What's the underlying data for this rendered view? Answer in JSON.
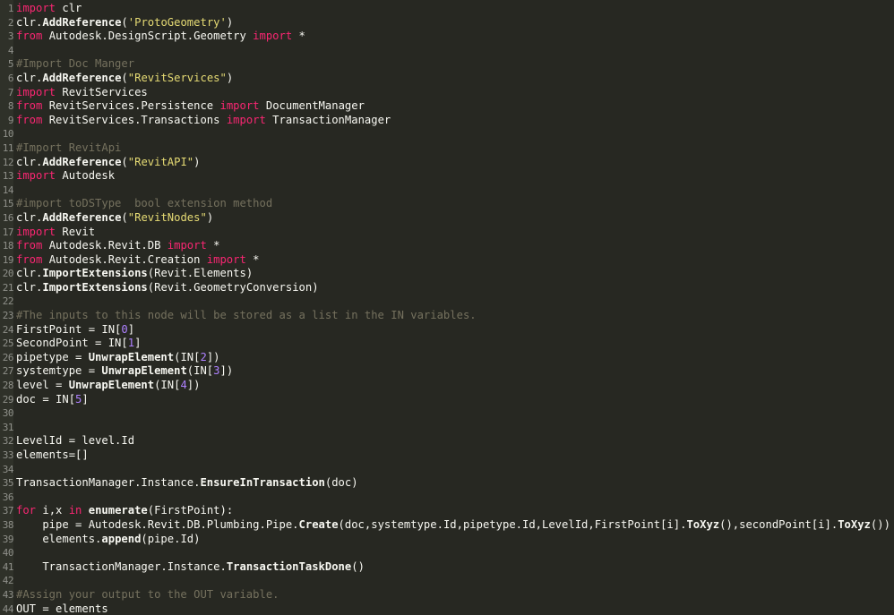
{
  "colors": {
    "background": "#272822",
    "gutter": "#2f3129",
    "line_number": "#8f908a",
    "text": "#f8f8f2",
    "keyword": "#f92672",
    "string": "#e6db74",
    "comment": "#75715e",
    "number": "#ae81ff"
  },
  "lines": [
    {
      "num": "1",
      "tokens": [
        {
          "t": "import",
          "c": "kw"
        },
        {
          "t": " clr",
          "c": "text"
        }
      ]
    },
    {
      "num": "2",
      "tokens": [
        {
          "t": "clr.",
          "c": "text"
        },
        {
          "t": "AddReference",
          "c": "fn"
        },
        {
          "t": "(",
          "c": "text"
        },
        {
          "t": "'ProtoGeometry'",
          "c": "str"
        },
        {
          "t": ")",
          "c": "text"
        }
      ]
    },
    {
      "num": "3",
      "tokens": [
        {
          "t": "from",
          "c": "kw"
        },
        {
          "t": " Autodesk.DesignScript.Geometry ",
          "c": "text"
        },
        {
          "t": "import",
          "c": "kw"
        },
        {
          "t": " *",
          "c": "text"
        }
      ]
    },
    {
      "num": "4",
      "tokens": []
    },
    {
      "num": "5",
      "tokens": [
        {
          "t": "#Import Doc Manger",
          "c": "com"
        }
      ]
    },
    {
      "num": "6",
      "tokens": [
        {
          "t": "clr.",
          "c": "text"
        },
        {
          "t": "AddReference",
          "c": "fn"
        },
        {
          "t": "(",
          "c": "text"
        },
        {
          "t": "\"RevitServices\"",
          "c": "str"
        },
        {
          "t": ")",
          "c": "text"
        }
      ]
    },
    {
      "num": "7",
      "tokens": [
        {
          "t": "import",
          "c": "kw"
        },
        {
          "t": " RevitServices",
          "c": "text"
        }
      ]
    },
    {
      "num": "8",
      "tokens": [
        {
          "t": "from",
          "c": "kw"
        },
        {
          "t": " RevitServices.Persistence ",
          "c": "text"
        },
        {
          "t": "import",
          "c": "kw"
        },
        {
          "t": " DocumentManager",
          "c": "text"
        }
      ]
    },
    {
      "num": "9",
      "tokens": [
        {
          "t": "from",
          "c": "kw"
        },
        {
          "t": " RevitServices.Transactions ",
          "c": "text"
        },
        {
          "t": "import",
          "c": "kw"
        },
        {
          "t": " TransactionManager",
          "c": "text"
        }
      ]
    },
    {
      "num": "10",
      "tokens": []
    },
    {
      "num": "11",
      "tokens": [
        {
          "t": "#Import RevitApi",
          "c": "com"
        }
      ]
    },
    {
      "num": "12",
      "tokens": [
        {
          "t": "clr.",
          "c": "text"
        },
        {
          "t": "AddReference",
          "c": "fn"
        },
        {
          "t": "(",
          "c": "text"
        },
        {
          "t": "\"RevitAPI\"",
          "c": "str"
        },
        {
          "t": ")",
          "c": "text"
        }
      ]
    },
    {
      "num": "13",
      "tokens": [
        {
          "t": "import",
          "c": "kw"
        },
        {
          "t": " Autodesk",
          "c": "text"
        }
      ]
    },
    {
      "num": "14",
      "tokens": []
    },
    {
      "num": "15",
      "tokens": [
        {
          "t": "#import toDSType  bool extension method",
          "c": "com"
        }
      ]
    },
    {
      "num": "16",
      "tokens": [
        {
          "t": "clr.",
          "c": "text"
        },
        {
          "t": "AddReference",
          "c": "fn"
        },
        {
          "t": "(",
          "c": "text"
        },
        {
          "t": "\"RevitNodes\"",
          "c": "str"
        },
        {
          "t": ")",
          "c": "text"
        }
      ]
    },
    {
      "num": "17",
      "tokens": [
        {
          "t": "import",
          "c": "kw"
        },
        {
          "t": " Revit",
          "c": "text"
        }
      ]
    },
    {
      "num": "18",
      "tokens": [
        {
          "t": "from",
          "c": "kw"
        },
        {
          "t": " Autodesk.Revit.DB ",
          "c": "text"
        },
        {
          "t": "import",
          "c": "kw"
        },
        {
          "t": " *",
          "c": "text"
        }
      ]
    },
    {
      "num": "19",
      "tokens": [
        {
          "t": "from",
          "c": "kw"
        },
        {
          "t": " Autodesk.Revit.Creation ",
          "c": "text"
        },
        {
          "t": "import",
          "c": "kw"
        },
        {
          "t": " *",
          "c": "text"
        }
      ]
    },
    {
      "num": "20",
      "tokens": [
        {
          "t": "clr.",
          "c": "text"
        },
        {
          "t": "ImportExtensions",
          "c": "fn"
        },
        {
          "t": "(Revit.Elements)",
          "c": "text"
        }
      ]
    },
    {
      "num": "21",
      "tokens": [
        {
          "t": "clr.",
          "c": "text"
        },
        {
          "t": "ImportExtensions",
          "c": "fn"
        },
        {
          "t": "(Revit.GeometryConversion)",
          "c": "text"
        }
      ]
    },
    {
      "num": "22",
      "tokens": []
    },
    {
      "num": "23",
      "tokens": [
        {
          "t": "#The inputs to this node will be stored as a list in the IN variables.",
          "c": "com"
        }
      ]
    },
    {
      "num": "24",
      "tokens": [
        {
          "t": "FirstPoint = IN[",
          "c": "text"
        },
        {
          "t": "0",
          "c": "num"
        },
        {
          "t": "]",
          "c": "text"
        }
      ]
    },
    {
      "num": "25",
      "tokens": [
        {
          "t": "SecondPoint = IN[",
          "c": "text"
        },
        {
          "t": "1",
          "c": "num"
        },
        {
          "t": "]",
          "c": "text"
        }
      ]
    },
    {
      "num": "26",
      "tokens": [
        {
          "t": "pipetype = ",
          "c": "text"
        },
        {
          "t": "UnwrapElement",
          "c": "fn"
        },
        {
          "t": "(IN[",
          "c": "text"
        },
        {
          "t": "2",
          "c": "num"
        },
        {
          "t": "])",
          "c": "text"
        }
      ]
    },
    {
      "num": "27",
      "tokens": [
        {
          "t": "systemtype = ",
          "c": "text"
        },
        {
          "t": "UnwrapElement",
          "c": "fn"
        },
        {
          "t": "(IN[",
          "c": "text"
        },
        {
          "t": "3",
          "c": "num"
        },
        {
          "t": "])",
          "c": "text"
        }
      ]
    },
    {
      "num": "28",
      "tokens": [
        {
          "t": "level = ",
          "c": "text"
        },
        {
          "t": "UnwrapElement",
          "c": "fn"
        },
        {
          "t": "(IN[",
          "c": "text"
        },
        {
          "t": "4",
          "c": "num"
        },
        {
          "t": "])",
          "c": "text"
        }
      ]
    },
    {
      "num": "29",
      "tokens": [
        {
          "t": "doc = IN[",
          "c": "text"
        },
        {
          "t": "5",
          "c": "num"
        },
        {
          "t": "]",
          "c": "text"
        }
      ]
    },
    {
      "num": "30",
      "tokens": []
    },
    {
      "num": "31",
      "tokens": []
    },
    {
      "num": "32",
      "tokens": [
        {
          "t": "LevelId = level.Id",
          "c": "text"
        }
      ]
    },
    {
      "num": "33",
      "tokens": [
        {
          "t": "elements=[]",
          "c": "text"
        }
      ]
    },
    {
      "num": "34",
      "tokens": []
    },
    {
      "num": "35",
      "tokens": [
        {
          "t": "TransactionManager.Instance.",
          "c": "text"
        },
        {
          "t": "EnsureInTransaction",
          "c": "fn"
        },
        {
          "t": "(doc)",
          "c": "text"
        }
      ]
    },
    {
      "num": "36",
      "tokens": []
    },
    {
      "num": "37",
      "tokens": [
        {
          "t": "for",
          "c": "kw"
        },
        {
          "t": " i,x ",
          "c": "text"
        },
        {
          "t": "in",
          "c": "kw"
        },
        {
          "t": " ",
          "c": "text"
        },
        {
          "t": "enumerate",
          "c": "fn"
        },
        {
          "t": "(FirstPoint):",
          "c": "text"
        }
      ]
    },
    {
      "num": "38",
      "tokens": [
        {
          "t": "    pipe = Autodesk.Revit.DB.Plumbing.Pipe.",
          "c": "text"
        },
        {
          "t": "Create",
          "c": "fn"
        },
        {
          "t": "(doc,systemtype.Id,pipetype.Id,LevelId,FirstPoint[i].",
          "c": "text"
        },
        {
          "t": "ToXyz",
          "c": "fn"
        },
        {
          "t": "(),secondPoint[i].",
          "c": "text"
        },
        {
          "t": "ToXyz",
          "c": "fn"
        },
        {
          "t": "())",
          "c": "text"
        }
      ]
    },
    {
      "num": "39",
      "tokens": [
        {
          "t": "    elements.",
          "c": "text"
        },
        {
          "t": "append",
          "c": "fn"
        },
        {
          "t": "(pipe.Id)",
          "c": "text"
        }
      ]
    },
    {
      "num": "40",
      "tokens": []
    },
    {
      "num": "41",
      "tokens": [
        {
          "t": "    TransactionManager.Instance.",
          "c": "text"
        },
        {
          "t": "TransactionTaskDone",
          "c": "fn"
        },
        {
          "t": "()",
          "c": "text"
        }
      ]
    },
    {
      "num": "42",
      "tokens": []
    },
    {
      "num": "43",
      "tokens": [
        {
          "t": "#Assign your output to the OUT variable.",
          "c": "com"
        }
      ]
    },
    {
      "num": "44",
      "tokens": [
        {
          "t": "OUT = elements",
          "c": "text"
        }
      ]
    }
  ]
}
